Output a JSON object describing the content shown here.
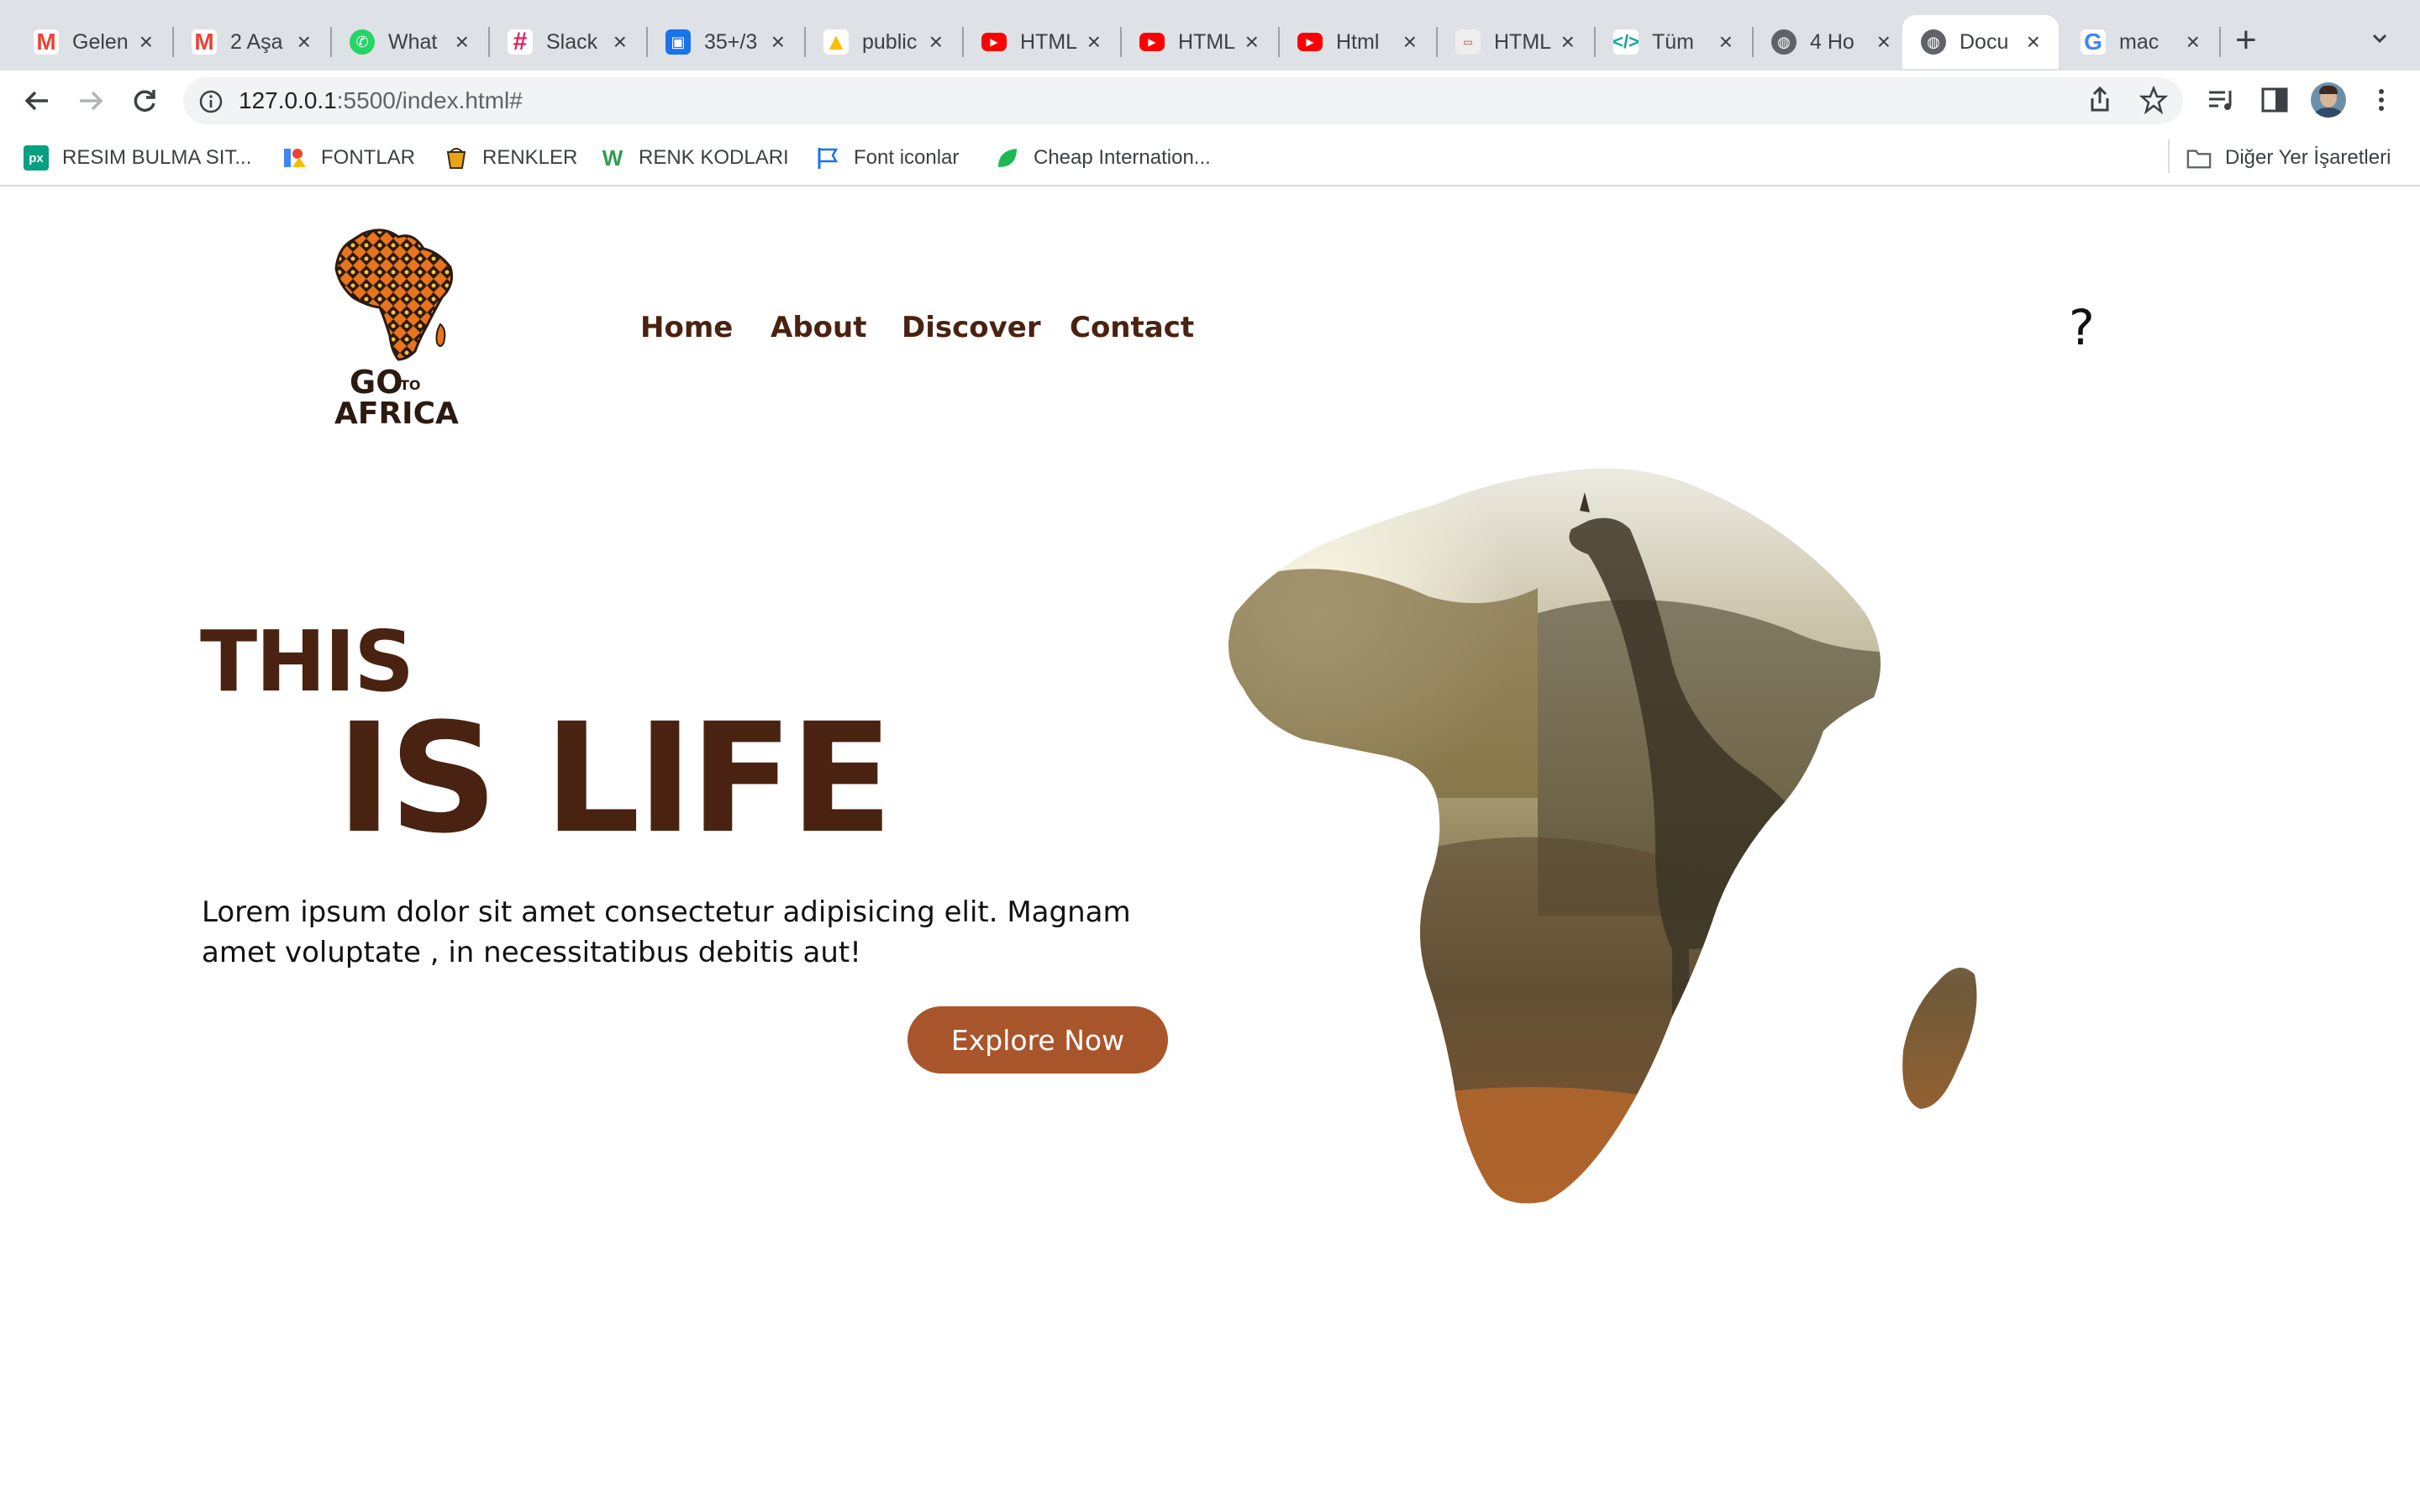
{
  "browser": {
    "tabs": [
      {
        "label": "Gelen",
        "icon": "gmail-icon",
        "color": "#ea4335"
      },
      {
        "label": "2 Aşa",
        "icon": "gmail-icon",
        "color": "#ea4335"
      },
      {
        "label": "What",
        "icon": "whatsapp-icon",
        "color": "#25d366"
      },
      {
        "label": "Slack",
        "icon": "slack-icon",
        "color": "#611f69"
      },
      {
        "label": "35+/3",
        "icon": "app-icon",
        "color": "#1a73e8"
      },
      {
        "label": "public",
        "icon": "drive-icon",
        "color": "#fbbc04"
      },
      {
        "label": "HTML",
        "icon": "youtube-icon",
        "color": "#ff0000"
      },
      {
        "label": "HTML",
        "icon": "youtube-icon",
        "color": "#ff0000"
      },
      {
        "label": "Html",
        "icon": "youtube-icon",
        "color": "#ff0000"
      },
      {
        "label": "HTML",
        "icon": "web-icon",
        "color": "#888888"
      },
      {
        "label": "Tüm",
        "icon": "code-icon",
        "color": "#1aa3a3"
      },
      {
        "label": "4 Ho",
        "icon": "globe-icon",
        "color": "#5f6368"
      },
      {
        "label": "Docu",
        "icon": "globe-icon",
        "color": "#5f6368",
        "active": true
      },
      {
        "label": "mac",
        "icon": "google-icon",
        "color": "#4285f4"
      }
    ],
    "url_host": "127.0.0.1",
    "url_rest": ":5500/index.html#",
    "bookmarks": [
      {
        "label": "RESIM BULMA SIT...",
        "icon": "px-icon",
        "color": "#05a081"
      },
      {
        "label": "FONTLAR",
        "icon": "fonts-icon",
        "color": "#4285f4"
      },
      {
        "label": "RENKLER",
        "icon": "bucket-icon",
        "color": "#e8a317"
      },
      {
        "label": "RENK KODLARI",
        "icon": "w-icon",
        "color": "#2e9e4f"
      },
      {
        "label": "Font iconlar",
        "icon": "flag-icon",
        "color": "#1a73e8"
      },
      {
        "label": "Cheap Internation...",
        "icon": "leaf-icon",
        "color": "#1db954"
      }
    ],
    "other_bookmarks": "Diğer Yer İşaretleri"
  },
  "site": {
    "logo_text_1": "GO",
    "logo_text_2": "TO",
    "logo_text_3": "AFRICA",
    "nav": [
      "Home",
      "About",
      "Discover",
      "Contact"
    ],
    "help_icon": "?",
    "hero_line1": "THIS",
    "hero_line2": "IS LIFE",
    "lead": "Lorem ipsum dolor sit amet consectetur adipisicing elit. Magnam amet voluptate , in necessitatibus debitis aut!",
    "cta": "Explore Now",
    "colors": {
      "brand": "#4a2211",
      "cta": "#a9552b"
    }
  }
}
